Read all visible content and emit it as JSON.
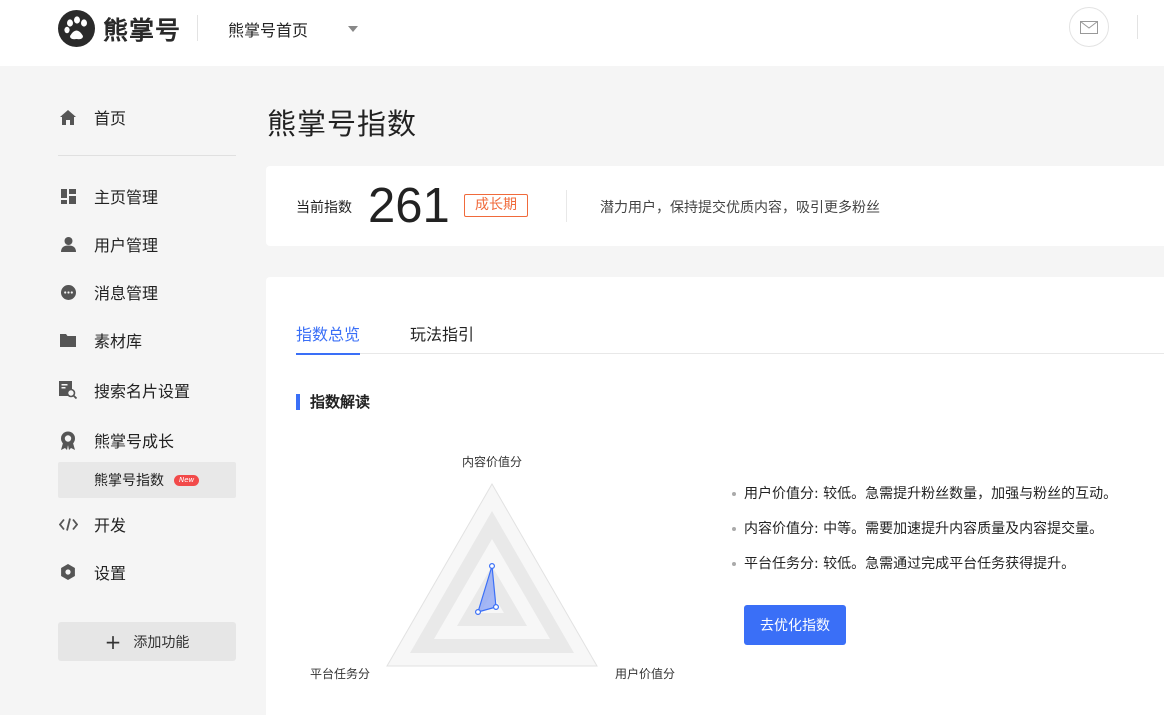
{
  "header": {
    "logo_text": "熊掌号",
    "nav_label": "熊掌号首页"
  },
  "sidebar": {
    "items": [
      {
        "label": "首页",
        "icon": "home-icon"
      },
      {
        "label": "主页管理",
        "icon": "dashboard-icon"
      },
      {
        "label": "用户管理",
        "icon": "user-icon"
      },
      {
        "label": "消息管理",
        "icon": "message-icon"
      },
      {
        "label": "素材库",
        "icon": "folder-icon"
      },
      {
        "label": "搜索名片设置",
        "icon": "search-card-icon"
      },
      {
        "label": "熊掌号成长",
        "icon": "medal-icon"
      },
      {
        "label": "开发",
        "icon": "code-icon"
      },
      {
        "label": "设置",
        "icon": "settings-icon"
      }
    ],
    "sub_item": {
      "label": "熊掌号指数",
      "badge": "New"
    },
    "add_button": "添加功能"
  },
  "main": {
    "title": "熊掌号指数",
    "index_card": {
      "label": "当前指数",
      "value": "261",
      "stage": "成长期",
      "description": "潜力用户，保持提交优质内容，吸引更多粉丝"
    },
    "tabs": [
      {
        "label": "指数总览",
        "active": true
      },
      {
        "label": "玩法指引",
        "active": false
      }
    ],
    "section_title": "指数解读",
    "radar": {
      "axes": [
        "内容价值分",
        "用户价值分",
        "平台任务分"
      ]
    },
    "bullets": [
      "用户价值分: 较低。急需提升粉丝数量，加强与粉丝的互动。",
      "内容价值分: 中等。需要加速提升内容质量及内容提交量。",
      "平台任务分: 较低。急需通过完成平台任务获得提升。"
    ],
    "optimize_button": "去优化指数"
  },
  "colors": {
    "accent": "#3a6ff7",
    "stage": "#f06a3b",
    "badge": "#f24a4a"
  }
}
